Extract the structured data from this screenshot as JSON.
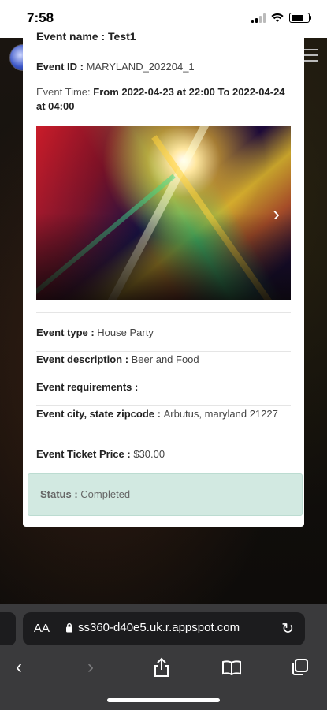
{
  "status_bar": {
    "time": "7:58"
  },
  "event": {
    "name_label": "Event name : Test1",
    "id_label": "Event ID : ",
    "id_value": "MARYLAND_202204_1",
    "time_label": "Event Time: ",
    "time_value": "From 2022-04-23 at 22:00 To 2022-04-24 at 04:00",
    "type_label": "Event type : ",
    "type_value": "House Party",
    "description_label": "Event description : ",
    "description_value": "Beer and Food",
    "requirements_label": "Event requirements : ",
    "requirements_value": "",
    "location_label": "Event city, state zipcode : ",
    "location_value": "Arbutus, maryland 21227",
    "price_label": "Event Ticket Price : ",
    "price_value": "$30.00",
    "status_label": "Status : ",
    "status_value": "Completed"
  },
  "browser": {
    "aa_label": "AA",
    "url": "ss360-d40e5.uk.r.appspot.com"
  },
  "colors": {
    "status_box_bg": "#d2e9e1",
    "safari_bar": "#3a3a3c"
  }
}
